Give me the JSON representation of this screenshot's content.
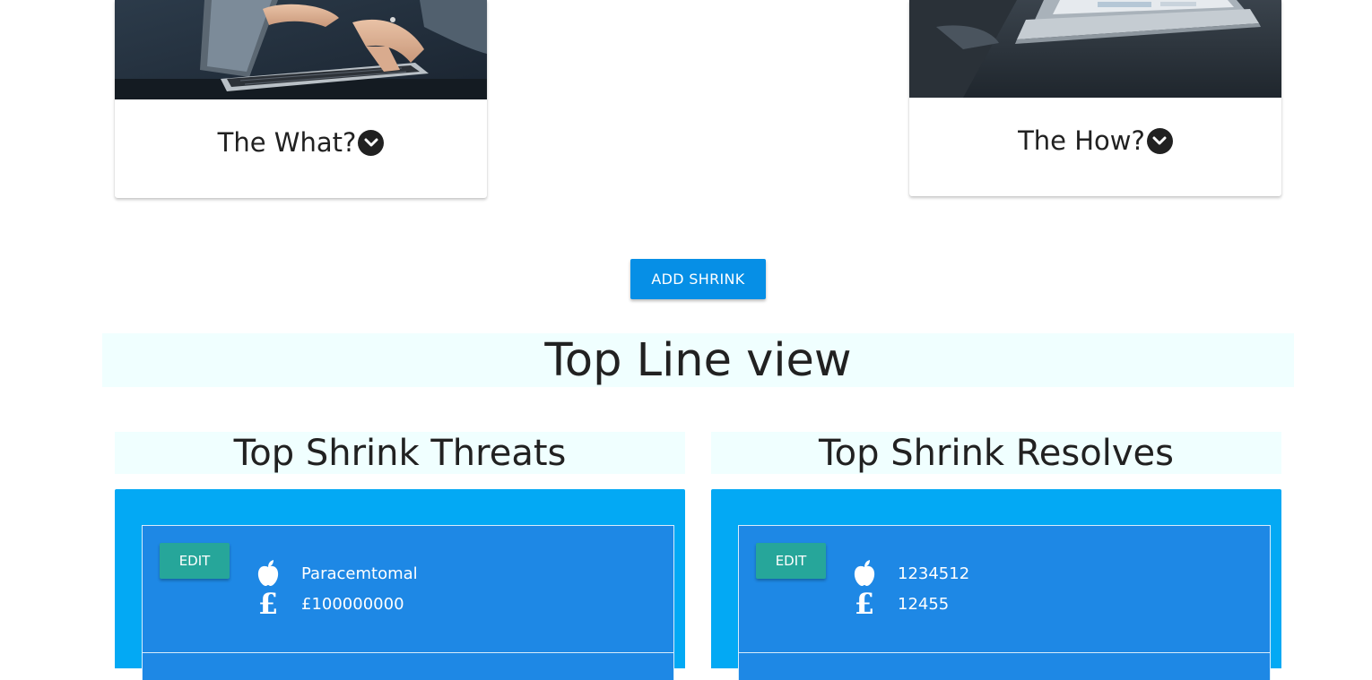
{
  "cards": {
    "what": {
      "title": "The What?",
      "image_icon": "laptop-typing-photo",
      "toggle_icon": "chevron-down-circle-icon"
    },
    "how": {
      "title": "The How?",
      "image_icon": "laptop-desk-photo",
      "toggle_icon": "chevron-down-circle-icon"
    }
  },
  "actions": {
    "add_shrink_label": "ADD SHRINK"
  },
  "top_line": {
    "title": "Top Line view"
  },
  "threats": {
    "title": "Top Shrink Threats",
    "items": [
      {
        "edit_label": "EDIT",
        "product_icon": "apple-icon",
        "product": "Paracemtomal",
        "value_icon": "pound-icon",
        "value": "£100000000"
      }
    ]
  },
  "resolves": {
    "title": "Top Shrink Resolves",
    "items": [
      {
        "edit_label": "EDIT",
        "product_icon": "apple-icon",
        "product": "1234512",
        "value_icon": "pound-icon",
        "value": "12455"
      }
    ]
  },
  "colors": {
    "primary_button": "#068fe6",
    "edit_button": "#26a69a",
    "panel_background": "#03a9f4",
    "item_background": "#1e88e5",
    "heading_background": "#f0ffff"
  }
}
